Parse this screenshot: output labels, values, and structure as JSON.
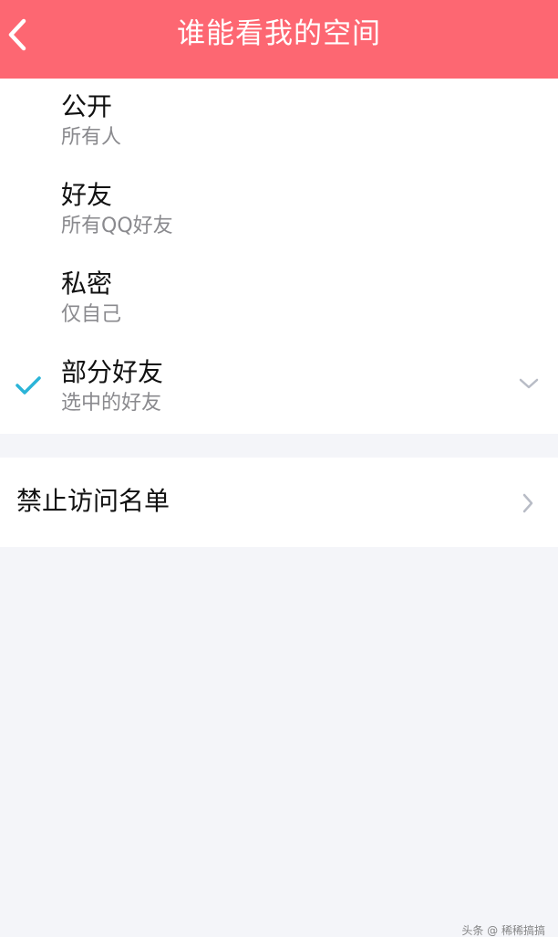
{
  "header": {
    "title": "谁能看我的空间",
    "background_color": "#fd6772"
  },
  "options": [
    {
      "title": "公开",
      "subtitle": "所有人",
      "selected": false
    },
    {
      "title": "好友",
      "subtitle": "所有QQ好友",
      "selected": false
    },
    {
      "title": "私密",
      "subtitle": "仅自己",
      "selected": false
    },
    {
      "title": "部分好友",
      "subtitle": "选中的好友",
      "selected": true,
      "expandable": true
    }
  ],
  "blocklist": {
    "label": "禁止访问名单"
  },
  "colors": {
    "check": "#2bb4d8",
    "chevron": "#b8bcc6",
    "page_background": "#f4f5f9"
  },
  "icons": {
    "back": "back-arrow-icon",
    "check": "checkmark-icon",
    "expand": "chevron-down-icon",
    "navigate": "chevron-right-icon"
  },
  "watermark": "头条 @ 稀稀搞搞"
}
